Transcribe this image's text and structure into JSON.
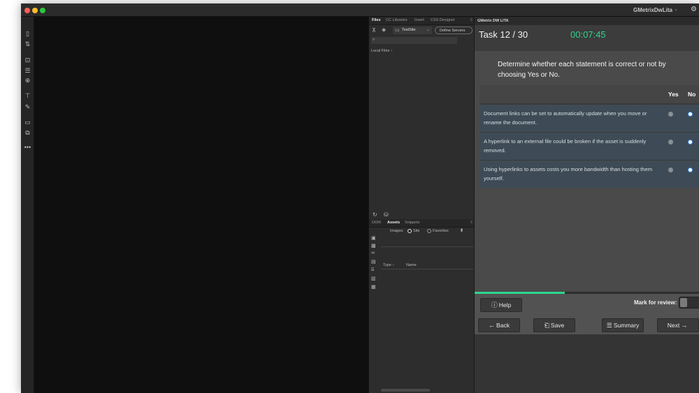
{
  "window": {
    "app_title": "GMetrixDwLita",
    "title_caret": "⌄",
    "gear_icon": "⚙"
  },
  "colors": {
    "close": "#ff5f57",
    "minimize": "#febc2e",
    "maximize": "#28c840",
    "accent_green": "#2fd58e",
    "radio_blue": "#3b8ef0"
  },
  "files_panel": {
    "tabs": [
      "Files",
      "CC Libraries",
      "Insert",
      "CSS Designer"
    ],
    "site_select": "TestSite",
    "define_servers": "Define Servers",
    "local_files": "Local Files ↑"
  },
  "assets_panel": {
    "tabs": [
      "DOM",
      "Assets",
      "Snippets"
    ],
    "images_label": "Images:",
    "radio_site": "Site",
    "radio_favorites": "Favorites",
    "col_type": "Type ↑",
    "col_name": "Name"
  },
  "gmetrix": {
    "header": "GMetrix DW LITA",
    "task": "Task 12 / 30",
    "timer": "00:07:45",
    "instruction": "Determine whether each statement is correct or not by choosing Yes or No.",
    "col_yes": "Yes",
    "col_no": "No",
    "statements": [
      {
        "text": "Document links can be set to automatically update when you move or rename the document.",
        "selected": "No"
      },
      {
        "text": "A hyperlink to an external file could be broken if the asset is suddenly removed.",
        "selected": "No"
      },
      {
        "text": "Using hyperlinks to assets costs you more bandwidth than hosting them yourself.",
        "selected": "No"
      }
    ],
    "progress_fraction": 0.4,
    "help": "Help",
    "mark_for_review": "Mark for review:",
    "back": "Back",
    "save": "Save",
    "summary": "Summary",
    "next": "Next"
  }
}
